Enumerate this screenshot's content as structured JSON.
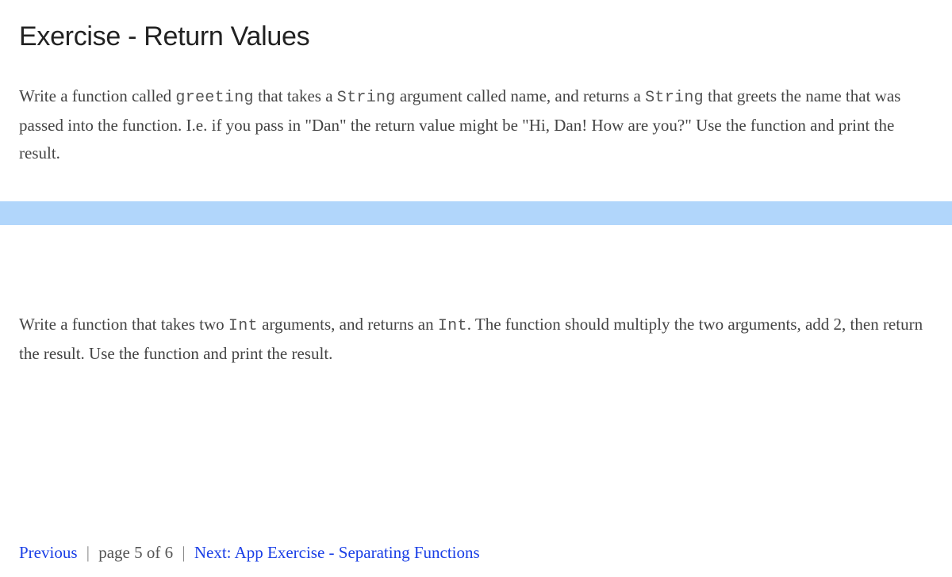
{
  "title": "Exercise - Return Values",
  "paragraph1": {
    "t1": "Write a function called ",
    "c1": "greeting",
    "t2": " that takes a ",
    "c2": "String",
    "t3": " argument called name, and returns a ",
    "c3": "String",
    "t4": " that greets the name that was passed into the function. I.e. if you pass in \"Dan\" the return value might be \"Hi, Dan! How are you?\" Use the function and print the result."
  },
  "paragraph2": {
    "t1": "Write a function that takes two ",
    "c1": "Int",
    "t2": " arguments, and returns an ",
    "c2": "Int",
    "t3": ". The function should multiply the two arguments, add 2, then return the result. Use the function and print the result."
  },
  "nav": {
    "previous": "Previous",
    "separator": "|",
    "page": "page 5 of 6",
    "next": "Next: App Exercise - Separating Functions"
  }
}
